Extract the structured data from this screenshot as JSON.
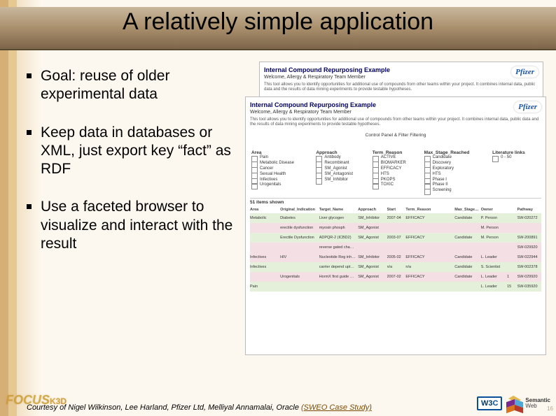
{
  "title": "A relatively simple application",
  "bullets": [
    "Goal: reuse of older experimental data",
    "Keep data in databases or XML, just export key “fact” as RDF",
    "Use a faceted browser to visualize and interact with the result"
  ],
  "figure": {
    "brand": "Pfizer",
    "back": {
      "title": "Internal Compound Repurposing Example",
      "subtitle": "Welcome, Allergy & Respiratory Team Member",
      "desc": "This tool allows you to identify opportunities for additional use of compounds from other teams within your project. It combines internal data, public data and the results of data mining experiments to provide testable hypotheses."
    },
    "front": {
      "title": "Internal Compound Repurposing Example",
      "subtitle": "Welcome, Allergy & Respiratory Team Member",
      "desc": "This tool allows you to identify opportunities for additional use of compounds from other teams within your project. It combines internal data, public data and the results of data mining experiments to provide testable hypotheses.",
      "filter_caption": "Control Panel & Filter Filtering",
      "filters": {
        "Area": [
          "Pain",
          "Metabolic Disease",
          "Cancer",
          "Sexual Health",
          "Infectives",
          "Urogenitals"
        ],
        "Approach": [
          "Antibody",
          "Recombinant",
          "SM_Agonist",
          "SM_Antagonist",
          "SM_Inhibitor"
        ],
        "Term_Reason": [
          "ACTIVE",
          "BIOMARKER",
          "EFFICACY",
          "HTS",
          "PKOPS",
          "TOXIC"
        ],
        "Max_Stage_Reached": [
          "Candidate",
          "Discovery",
          "Exploratory",
          "HTS",
          "Phase I",
          "Phase II",
          "Screening"
        ],
        "Literature links": [
          "0 - 50"
        ]
      },
      "results_caption": "51 items shown",
      "results_headers": [
        "Area",
        "Original_Indication",
        "Target_Name",
        "Approach",
        "Start",
        "Term_Reason",
        "Max_Stage_Reached",
        "Owner",
        "",
        "Pathway"
      ],
      "results": [
        {
          "color": "green",
          "cells": [
            "Metabolic",
            "Diabetes",
            "Liver glycogen",
            "SM_Inhibitor",
            "2007-04",
            "EFFICACY",
            "Candidate",
            "P. Person",
            "",
            "SW-020272"
          ]
        },
        {
          "color": "pink",
          "cells": [
            "",
            "erectile dysfunction",
            "myosin phosph",
            "SM_Agonist",
            "",
            "",
            "",
            "M. Person",
            "",
            ""
          ]
        },
        {
          "color": "green",
          "cells": [
            "",
            "Erectile Dysfunction",
            "ADPQR-2 (ICBD2)",
            "SM_Agonist",
            "2003-07",
            "EFFICACY",
            "Candidate",
            "M. Person",
            "",
            "SW-200891"
          ]
        },
        {
          "color": "pink",
          "cells": [
            "",
            "",
            "reverse gated channel SM_Antagonist",
            "",
            "",
            "",
            "",
            "",
            "",
            "SW-029920"
          ]
        },
        {
          "color": "pink",
          "cells": [
            "Infectives",
            "HIV",
            "Nucleotide Reg inhibitor♯ actin & troXm ♯",
            "SM_Inhibitor",
            "2005-02",
            "EFFICACY",
            "Candidate",
            "L. Leader",
            "",
            "SW-022944"
          ]
        },
        {
          "color": "green",
          "cells": [
            "Infectives",
            "",
            "carrier depend uptake repressor novel reg",
            "SM_Agonist",
            "n/a",
            "n/a",
            "Candidate",
            "S. Scientist",
            "",
            "SW-002378"
          ]
        },
        {
          "color": "pink",
          "cells": [
            "",
            "Urogenitals",
            "HormX first guide novel reg gene",
            "SM_Agonist",
            "2007-02",
            "EFFICACY",
            "Candidate",
            "L. Leader",
            "1",
            "SW-029920"
          ]
        },
        {
          "color": "green",
          "cells": [
            "Pain",
            "",
            "",
            "",
            "",
            "",
            "",
            "L. Leader",
            "15",
            "SW-035920"
          ]
        }
      ]
    }
  },
  "footer": {
    "text": "Courtesy of Nigel Wilkinson, Lee Harland, Pfizer Ltd, Melliyal Annamalai, Oracle ",
    "link_text": "(SWEO Case Study)"
  },
  "focus_logo": "FOCUS",
  "focus_k": "K3D",
  "sw_text_top": "Semantic",
  "sw_text_bot": "Web",
  "page_number": "16"
}
